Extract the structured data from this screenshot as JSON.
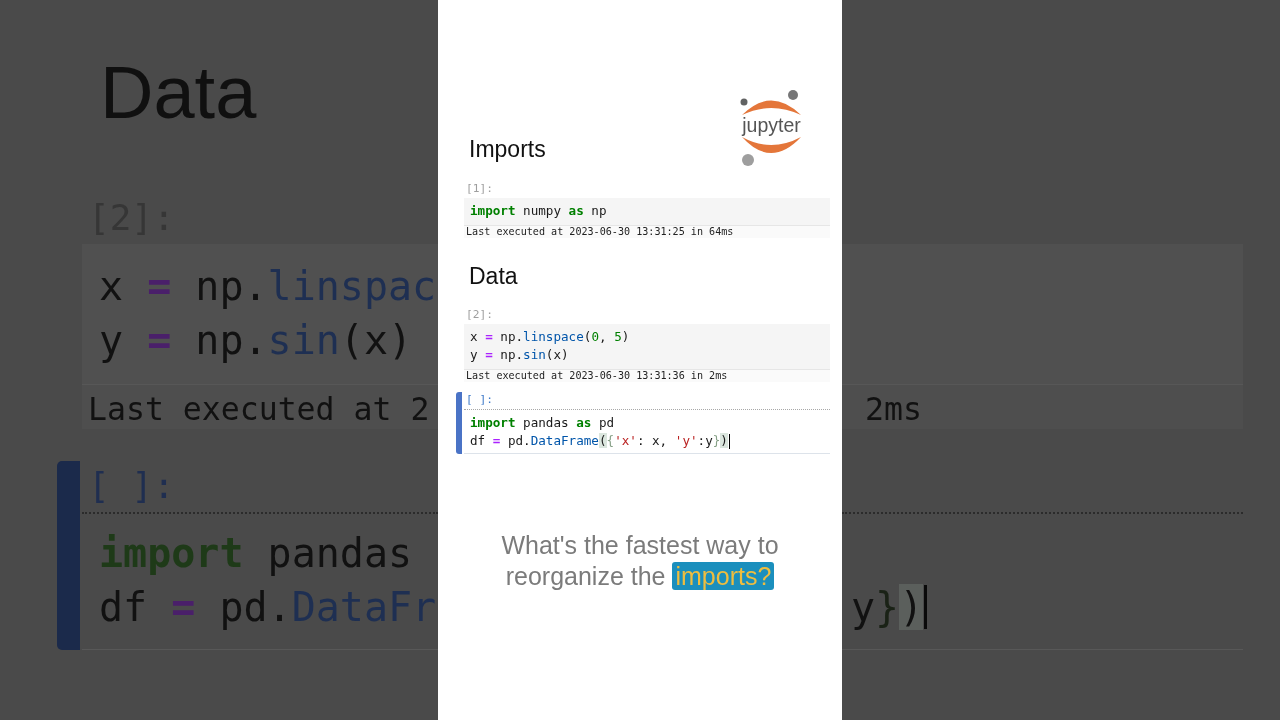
{
  "notebook": {
    "logo": {
      "text": "jupyter"
    },
    "sections": [
      {
        "heading": "Imports",
        "cells": [
          {
            "prompt": "[1]:",
            "active": false,
            "lines": [
              {
                "cursor": false,
                "tokens": [
                  {
                    "text": "import",
                    "kind": "keyword"
                  },
                  {
                    "text": " numpy ",
                    "kind": "plain"
                  },
                  {
                    "text": "as",
                    "kind": "keyword"
                  },
                  {
                    "text": " np",
                    "kind": "plain"
                  }
                ]
              }
            ],
            "output": "Last executed at 2023-06-30 13:31:25 in 64ms"
          }
        ]
      },
      {
        "heading": "Data",
        "cells": [
          {
            "prompt": "[2]:",
            "active": false,
            "lines": [
              {
                "cursor": false,
                "tokens": [
                  {
                    "text": "x ",
                    "kind": "plain"
                  },
                  {
                    "text": "=",
                    "kind": "operator"
                  },
                  {
                    "text": " np.",
                    "kind": "plain"
                  },
                  {
                    "text": "linspace",
                    "kind": "property"
                  },
                  {
                    "text": "(",
                    "kind": "plain"
                  },
                  {
                    "text": "0",
                    "kind": "number"
                  },
                  {
                    "text": ", ",
                    "kind": "plain"
                  },
                  {
                    "text": "5",
                    "kind": "number"
                  },
                  {
                    "text": ")",
                    "kind": "plain"
                  }
                ]
              },
              {
                "cursor": false,
                "tokens": [
                  {
                    "text": "y ",
                    "kind": "plain"
                  },
                  {
                    "text": "=",
                    "kind": "operator"
                  },
                  {
                    "text": " np.",
                    "kind": "plain"
                  },
                  {
                    "text": "sin",
                    "kind": "property"
                  },
                  {
                    "text": "(x)",
                    "kind": "plain"
                  }
                ]
              }
            ],
            "output": "Last executed at 2023-06-30 13:31:36 in 2ms"
          },
          {
            "prompt": "[ ]:",
            "active": true,
            "lines": [
              {
                "cursor": false,
                "tokens": [
                  {
                    "text": "import",
                    "kind": "keyword"
                  },
                  {
                    "text": " pandas ",
                    "kind": "plain"
                  },
                  {
                    "text": "as",
                    "kind": "keyword"
                  },
                  {
                    "text": " pd",
                    "kind": "plain"
                  }
                ]
              },
              {
                "cursor": true,
                "tokens": [
                  {
                    "text": "df ",
                    "kind": "plain"
                  },
                  {
                    "text": "=",
                    "kind": "operator"
                  },
                  {
                    "text": " pd.",
                    "kind": "plain"
                  },
                  {
                    "text": "DataFrame",
                    "kind": "property"
                  },
                  {
                    "text": "(",
                    "kind": "match"
                  },
                  {
                    "text": "{",
                    "kind": "brace"
                  },
                  {
                    "text": "'x'",
                    "kind": "string"
                  },
                  {
                    "text": ": x, ",
                    "kind": "plain"
                  },
                  {
                    "text": "'y'",
                    "kind": "string"
                  },
                  {
                    "text": ":y",
                    "kind": "plain"
                  },
                  {
                    "text": "}",
                    "kind": "brace"
                  },
                  {
                    "text": ")",
                    "kind": "match"
                  }
                ]
              }
            ]
          }
        ]
      }
    ]
  },
  "caption": {
    "lines": [
      {
        "parts": [
          {
            "text": "What's the fastest way to",
            "highlighted": false
          }
        ]
      },
      {
        "parts": [
          {
            "text": "reorganize the ",
            "highlighted": false
          },
          {
            "text": "imports?",
            "highlighted": true
          }
        ]
      }
    ]
  },
  "backdrop": {
    "left": {
      "heading": "Data",
      "cells": [
        {
          "prompt": "[2]:",
          "active": false,
          "lines": [
            {
              "cursor": false,
              "tokens": [
                {
                  "text": "x ",
                  "kind": "plain"
                },
                {
                  "text": "=",
                  "kind": "operator"
                },
                {
                  "text": " np.",
                  "kind": "plain"
                },
                {
                  "text": "linspac",
                  "kind": "property"
                }
              ]
            },
            {
              "cursor": false,
              "tokens": [
                {
                  "text": "y ",
                  "kind": "plain"
                },
                {
                  "text": "=",
                  "kind": "operator"
                },
                {
                  "text": " np.",
                  "kind": "plain"
                },
                {
                  "text": "sin",
                  "kind": "property"
                },
                {
                  "text": "(x)",
                  "kind": "plain"
                }
              ]
            }
          ],
          "output": "Last executed at 2"
        },
        {
          "prompt": "[ ]:",
          "active": true,
          "lines": [
            {
              "cursor": false,
              "tokens": [
                {
                  "text": "import",
                  "kind": "keyword"
                },
                {
                  "text": " pandas",
                  "kind": "plain"
                }
              ]
            },
            {
              "cursor": false,
              "tokens": [
                {
                  "text": "df ",
                  "kind": "plain"
                },
                {
                  "text": "=",
                  "kind": "operator"
                },
                {
                  "text": " pd.",
                  "kind": "plain"
                },
                {
                  "text": "DataFr",
                  "kind": "property"
                }
              ]
            }
          ]
        }
      ]
    },
    "right": {
      "cells": [
        {
          "active": false,
          "output": "2ms"
        },
        {
          "active": true,
          "lines": [
            {
              "cursor": true,
              "tokens": [
                {
                  "text": "y",
                  "kind": "plain"
                },
                {
                  "text": "}",
                  "kind": "brace"
                },
                {
                  "text": ")",
                  "kind": "match"
                }
              ]
            }
          ]
        }
      ]
    }
  }
}
